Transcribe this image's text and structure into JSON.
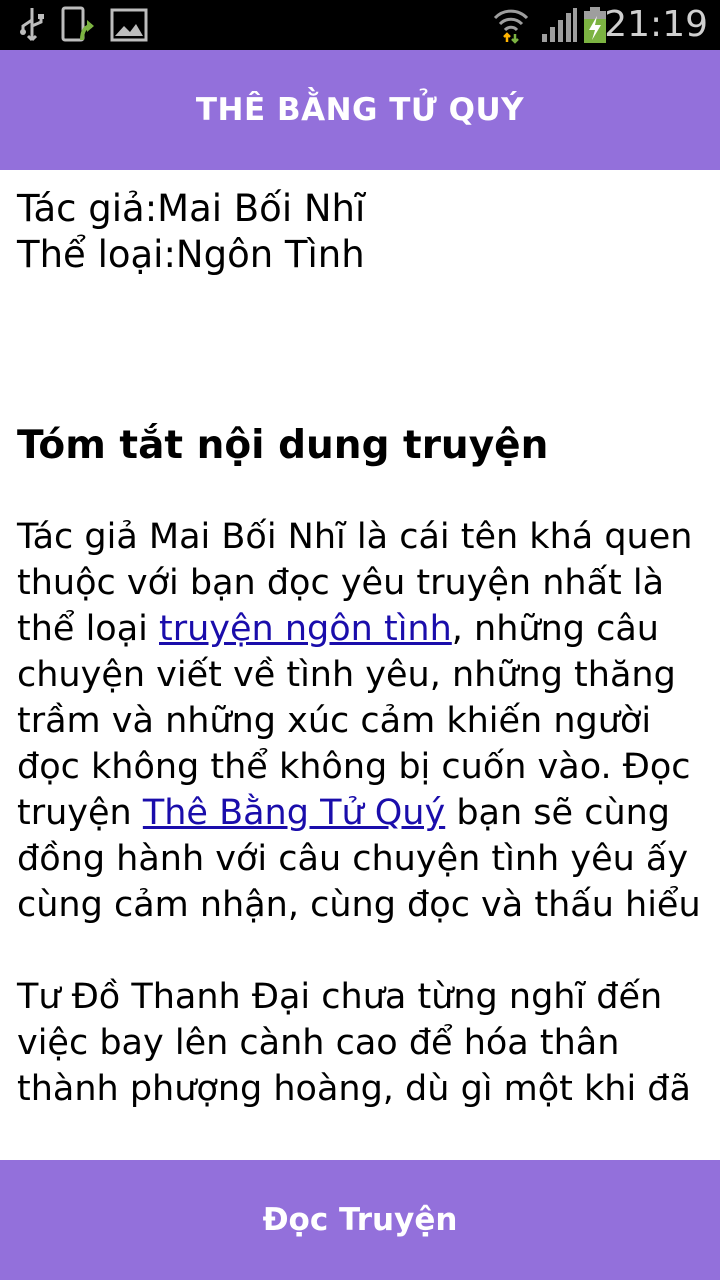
{
  "status_bar": {
    "time": "21:19",
    "left_icons": [
      "usb-icon",
      "phone-update-icon",
      "image-icon"
    ],
    "right_icons": [
      "wifi-icon",
      "signal-icon",
      "battery-charging-icon"
    ]
  },
  "header": {
    "title": "THÊ BẰNG TỬ QUÝ",
    "color": "#9370db"
  },
  "meta": {
    "author": "Tác giả:Mai Bối Nhĩ",
    "genre": "Thể loại:Ngôn Tình"
  },
  "summary": {
    "heading": "Tóm tắt nội dung truyện",
    "p1": {
      "t1": "Tác giả Mai Bối Nhĩ là cái tên khá quen thuộc với bạn đọc yêu truyện nhất là thể loại ",
      "link1": "truyện ngôn tình",
      "t2": ", những câu chuyện viết về tình yêu, những thăng trầm và những xúc cảm khiến người đọc không thể không bị cuốn vào. Đọc truyện ",
      "link2": "Thê Bằng Tử Quý",
      "t3": " bạn sẽ cùng đồng hành với câu chuyện tình yêu ấy cùng cảm nhận, cùng đọc và thấu hiểu"
    },
    "p2": "Tư Đồ Thanh Đại chưa từng nghĩ đến việc bay lên cành cao để hóa thân thành phượng hoàng, dù gì một khi đã"
  },
  "bottom_bar": {
    "label": "Đọc Truyện"
  }
}
